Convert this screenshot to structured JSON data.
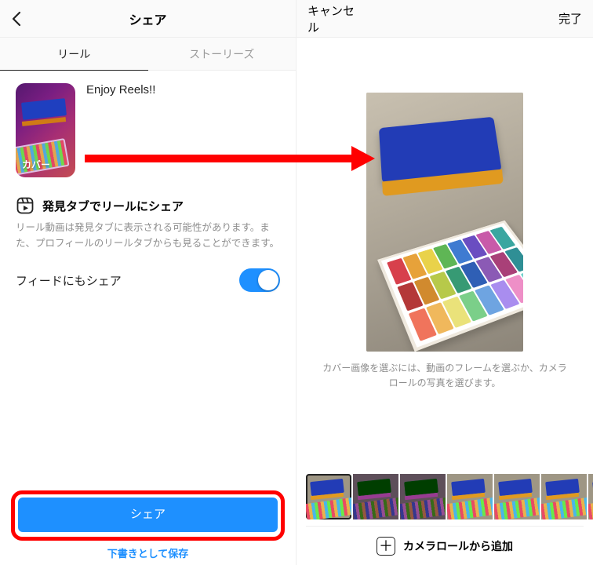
{
  "left": {
    "header": {
      "back_aria": "back",
      "title": "シェア"
    },
    "tabs": {
      "reels": "リール",
      "stories": "ストーリーズ"
    },
    "cover_label": "カバー",
    "caption": "Enjoy Reels!!",
    "discover_title": "発見タブでリールにシェア",
    "discover_help": "リール動画は発見タブに表示される可能性があります。また、プロフィールのリールタブからも見ることができます。",
    "feed_toggle_label": "フィードにもシェア",
    "feed_toggle_on": true,
    "primary_button": "シェア",
    "save_draft": "下書きとして保存"
  },
  "right": {
    "header": {
      "cancel": "キャンセル",
      "done": "完了"
    },
    "hint": "カバー画像を選ぶには、動画のフレームを選ぶか、カメラロールの写真を選びます。",
    "add_from_roll": "カメラロールから追加"
  },
  "colors": {
    "accent": "#1e90ff",
    "highlight": "#ff0000"
  }
}
